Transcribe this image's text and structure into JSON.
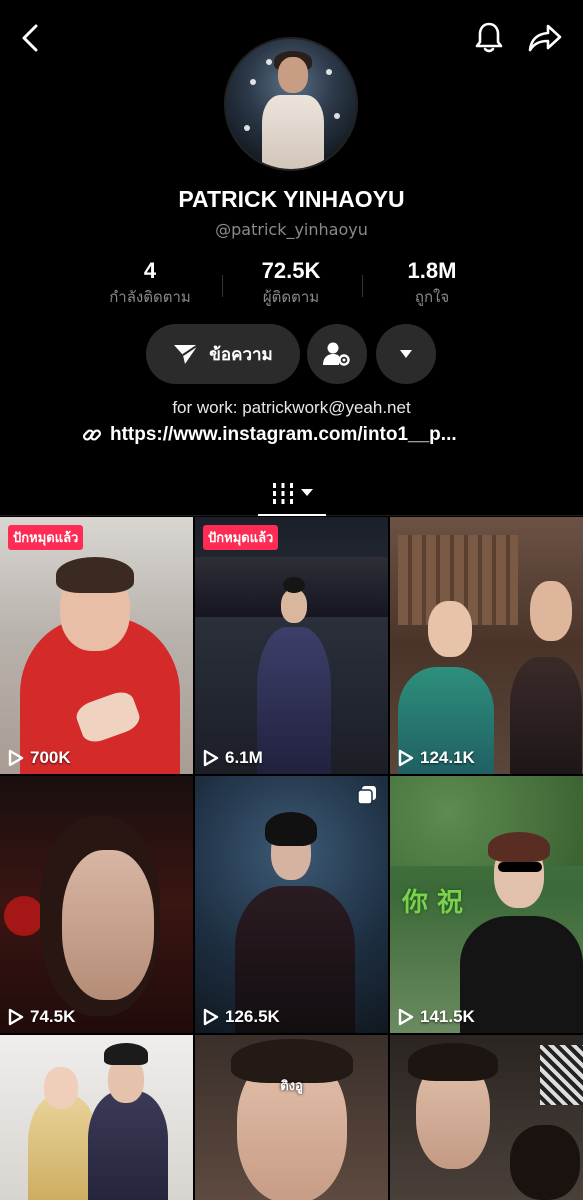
{
  "header": {
    "back_icon": "chevron-left-icon",
    "bell_icon": "bell-icon",
    "share_icon": "share-arrow-icon"
  },
  "profile": {
    "display_name": "PATRICK YINHAOYU",
    "handle": "@patrick_yinhaoyu",
    "stats": [
      {
        "value": "4",
        "label": "กำลังติดตาม"
      },
      {
        "value": "72.5K",
        "label": "ผู้ติดตาม"
      },
      {
        "value": "1.8M",
        "label": "ถูกใจ"
      }
    ],
    "bio": "for work: patrickwork@yeah.net",
    "link": "https://www.instagram.com/into1__p..."
  },
  "actions": {
    "message_label": "ข้อความ",
    "message_icon": "paper-plane-icon",
    "friend_settings_icon": "person-gear-icon",
    "more_icon": "triangle-down-icon"
  },
  "tabs": {
    "grid_icon": "videos-grid-icon",
    "dropdown_icon": "caret-down-icon"
  },
  "videos": [
    {
      "views": "700K",
      "pinned_label": "ปักหมุดแล้ว",
      "caption": ""
    },
    {
      "views": "6.1M",
      "pinned_label": "ปักหมุดแล้ว",
      "caption": ""
    },
    {
      "views": "124.1K",
      "pinned_label": "",
      "caption": ""
    },
    {
      "views": "74.5K",
      "pinned_label": "",
      "caption": ""
    },
    {
      "views": "126.5K",
      "pinned_label": "",
      "caption": ""
    },
    {
      "views": "141.5K",
      "pinned_label": "",
      "caption": "你 祝"
    },
    {
      "views": "",
      "pinned_label": "",
      "caption": ""
    },
    {
      "views": "",
      "pinned_label": "",
      "caption": "ติงอู"
    },
    {
      "views": "",
      "pinned_label": "",
      "caption": ""
    }
  ],
  "colors": {
    "background": "#000000",
    "pin_badge": "#fe2c55",
    "button_bg": "#2b2b2b",
    "muted_text": "#8a8a8a"
  }
}
